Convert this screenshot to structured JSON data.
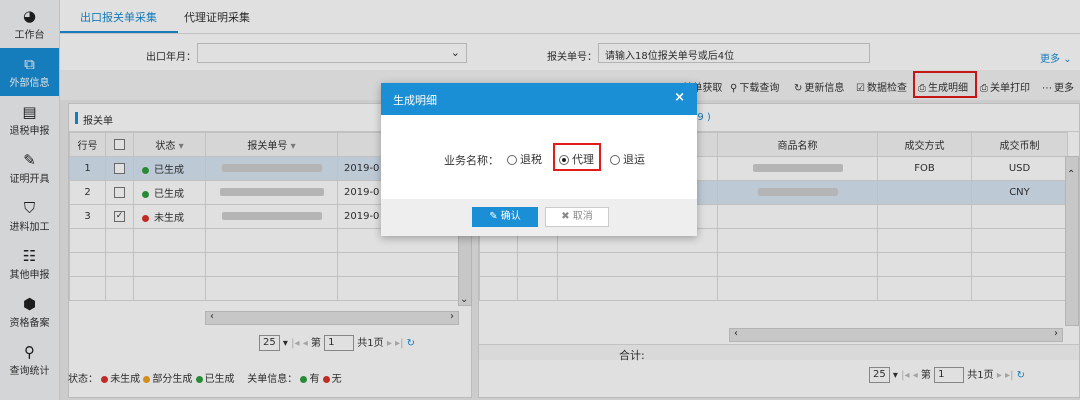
{
  "sidebar": {
    "items": [
      {
        "icon": "dashboard-icon",
        "label": "工作台"
      },
      {
        "icon": "external-info-icon",
        "label": "外部信息"
      },
      {
        "icon": "document-icon",
        "label": "退税申报"
      },
      {
        "icon": "edit-icon",
        "label": "证明开具"
      },
      {
        "icon": "shield-icon",
        "label": "进料加工"
      },
      {
        "icon": "org-chart-icon",
        "label": "其他申报"
      },
      {
        "icon": "package-icon",
        "label": "资格备案"
      },
      {
        "icon": "search-icon",
        "label": "查询统计"
      }
    ]
  },
  "tabs": [
    {
      "label": "出口报关单采集"
    },
    {
      "label": "代理证明采集"
    }
  ],
  "filter": {
    "month_label": "出口年月：",
    "customs_label": "报关单号：",
    "customs_value": "请输入18位报关单号或后4位",
    "more": "更多"
  },
  "toolbar": {
    "items": [
      "关单获取",
      "下载查询",
      "更新信息",
      "数据检查",
      "生成明细",
      "关单打印",
      "更多"
    ]
  },
  "left_panel": {
    "title": "报关单",
    "headers": [
      "行号",
      "",
      "状态",
      "报关单号",
      "出口日"
    ],
    "rows": [
      {
        "no": "1",
        "checked": "",
        "status": "已生成",
        "date": "2019-0"
      },
      {
        "no": "2",
        "checked": "",
        "status": "已生成",
        "date": "2019-0"
      },
      {
        "no": "3",
        "checked": "✓",
        "status": "未生成",
        "date": "2019-0"
      }
    ],
    "pager": {
      "size": "25",
      "page_label": "第",
      "page": "1",
      "total": "共1页"
    }
  },
  "right_panel": {
    "title_suffix": "89 )",
    "headers": [
      "商品名称",
      "成交方式",
      "成交币制"
    ],
    "rows": [
      {
        "method": "FOB",
        "currency": "USD"
      },
      {
        "method": "",
        "currency": "CNY"
      }
    ],
    "total_label": "合计:",
    "pager": {
      "size": "25",
      "page_label": "第",
      "page": "1",
      "total": "共1页"
    }
  },
  "status_bar": {
    "status_label": "状态：",
    "s1": "未生成",
    "s2": "部分生成",
    "s3": "已生成",
    "info_label": "关单信息：",
    "i1": "有",
    "i2": "无"
  },
  "colors": {
    "accent": "#1a8fd6",
    "green": "#2e9e3e",
    "red": "#d9342b",
    "orange": "#f0a21e",
    "highlight": "#e21b1b"
  },
  "modal": {
    "title": "生成明细",
    "field_label": "业务名称：",
    "options": [
      "退税",
      "代理",
      "退运"
    ],
    "selected": "代理",
    "ok": "确认",
    "cancel": "取消"
  }
}
